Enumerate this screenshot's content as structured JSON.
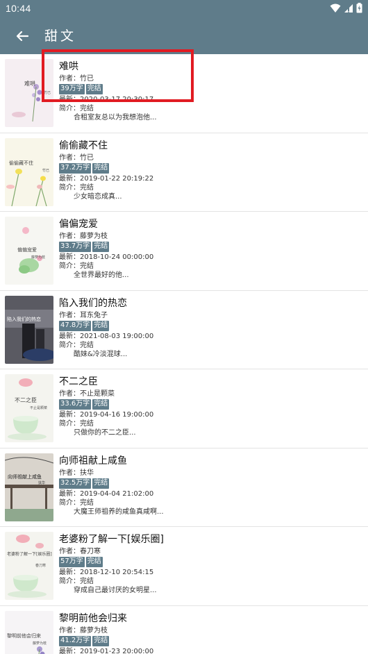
{
  "status_bar": {
    "time": "10:44",
    "icons": [
      "wifi-icon",
      "signal-icon",
      "battery-icon"
    ]
  },
  "toolbar": {
    "back_icon": "arrow-left-icon",
    "title": "甜文"
  },
  "colors": {
    "primary": "#5f7c8a",
    "highlight": "#e11b22"
  },
  "labels": {
    "author_prefix": "作者：",
    "latest_prefix": "最新：",
    "intro_prefix": "简介："
  },
  "books": [
    {
      "title": "难哄",
      "author": "竹已",
      "words": "39万字",
      "status": "完结",
      "latest": "2020-03-17 20:30:17",
      "intro_status": "完结",
      "intro": "合租室友总以为我想泡他...",
      "cover_text": "难哄",
      "cover_sub": "竹已"
    },
    {
      "title": "偷偷藏不住",
      "author": "竹已",
      "words": "37.2万字",
      "status": "完结",
      "latest": "2019-01-22 20:19:22",
      "intro_status": "完结",
      "intro": "少女暗恋成真...",
      "cover_text": "偷偷藏不住",
      "cover_sub": "竹已"
    },
    {
      "title": "偏偏宠爱",
      "author": "藤萝为枝",
      "words": "33.7万字",
      "status": "完结",
      "latest": "2018-10-24 00:00:00",
      "intro_status": "完结",
      "intro": "全世界最好的他...",
      "cover_text": "偏偏宠爱",
      "cover_sub": "藤萝为枝"
    },
    {
      "title": "陷入我们的热恋",
      "author": "耳东兔子",
      "words": "47.8万字",
      "status": "完结",
      "latest": "2021-08-03 19:00:00",
      "intro_status": "完结",
      "intro": "酷妹&冷淡混球...",
      "cover_text": "陷入我们的热恋",
      "cover_sub": ""
    },
    {
      "title": "不二之臣",
      "author": "不止是颗菜",
      "words": "33.6万字",
      "status": "完结",
      "latest": "2019-04-16 19:00:00",
      "intro_status": "完结",
      "intro": "只做你的不二之臣...",
      "cover_text": "不二之臣",
      "cover_sub": "不止是颗菜"
    },
    {
      "title": "向师祖献上咸鱼",
      "author": "扶华",
      "words": "32.5万字",
      "status": "完结",
      "latest": "2019-04-04 21:02:00",
      "intro_status": "完结",
      "intro": "大魔王师祖养的咸鱼真咸啊...",
      "cover_text": "向师祖献上咸鱼",
      "cover_sub": "扶华"
    },
    {
      "title": "老婆粉了解一下[娱乐圈]",
      "author": "春刀寒",
      "words": "57万字",
      "status": "完结",
      "latest": "2018-12-10 20:54:15",
      "intro_status": "完结",
      "intro": "穿成自己最讨厌的女明星...",
      "cover_text": "老婆粉了解一下[娱乐圈]",
      "cover_sub": "春刀寒"
    },
    {
      "title": "黎明前他会归来",
      "author": "藤萝为枝",
      "words": "41.2万字",
      "status": "完结",
      "latest": "2019-01-23 20:00:00",
      "intro_status": "完结",
      "intro": "",
      "cover_text": "黎明前他会归来",
      "cover_sub": "藤萝为枝"
    }
  ]
}
